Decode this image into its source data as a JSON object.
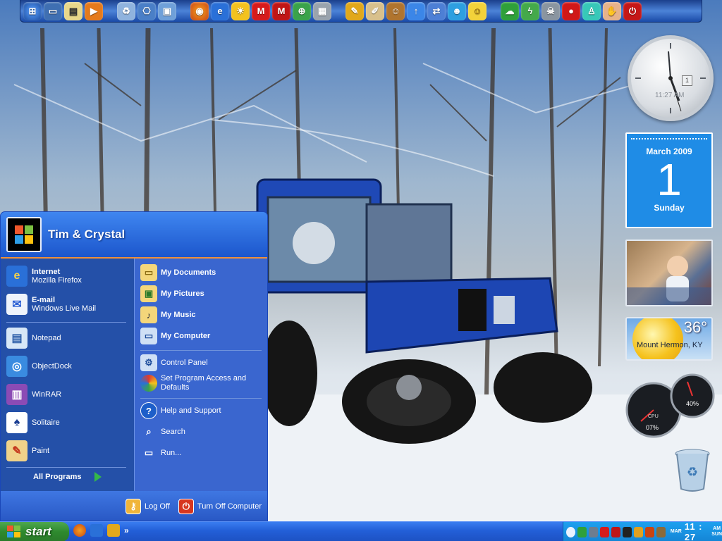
{
  "start_menu": {
    "user_name": "Tim & Crystal",
    "pinned": [
      {
        "title": "Internet",
        "subtitle": "Mozilla Firefox"
      },
      {
        "title": "E-mail",
        "subtitle": "Windows Live Mail"
      }
    ],
    "recent": [
      "Notepad",
      "ObjectDock",
      "WinRAR",
      "Solitaire",
      "Paint"
    ],
    "all_programs": "All Programs",
    "places": [
      "My Documents",
      "My Pictures",
      "My Music",
      "My Computer"
    ],
    "settings": [
      "Control Panel",
      "Set Program Access and Defaults"
    ],
    "help": [
      "Help and Support",
      "Search",
      "Run..."
    ],
    "log_off": "Log Off",
    "turn_off": "Turn Off Computer"
  },
  "gadgets": {
    "clock_time": "11:27 AM",
    "clock_day": "1",
    "calendar_month": "March 2009",
    "calendar_day": "1",
    "calendar_weekday": "Sunday",
    "weather_temp": "36°",
    "weather_location": "Mount Hermon, KY",
    "cpu_label": "CPU",
    "cpu_percent": "07%",
    "mem_percent": "40%"
  },
  "taskbar": {
    "start_label": "start",
    "clock": "11 : 27",
    "clock_ampm": "AM",
    "clock_month": "MAR",
    "clock_weekday": "SUN",
    "chevron": "»"
  },
  "colors": {
    "accent_blue": "#2a5fd4",
    "start_green": "#2e8a2e",
    "calendar_blue": "#1f8ce6"
  }
}
